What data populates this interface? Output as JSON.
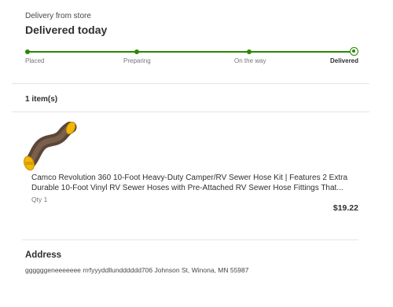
{
  "delivery": {
    "label": "Delivery from store",
    "status": "Delivered today"
  },
  "tracker": {
    "stages": [
      {
        "label": "Placed",
        "complete": true
      },
      {
        "label": "Preparing",
        "complete": true
      },
      {
        "label": "On the way",
        "complete": true
      },
      {
        "label": "Delivered",
        "complete": true,
        "current": true
      }
    ],
    "accent_color": "#2a8703"
  },
  "items": {
    "count_label": "1 item(s)",
    "list": [
      {
        "title": "Camco Revolution 360 10-Foot Heavy-Duty Camper/RV Sewer Hose Kit | Features 2 Extra Durable 10-Foot Vinyl RV Sewer Hoses with Pre-Attached RV Sewer Hose Fittings That...",
        "qty": "Qty 1",
        "price": "$19.22",
        "image_icon": "sewer-hose-image"
      }
    ]
  },
  "address": {
    "title": "Address",
    "text": "ggggggeneeeeeee rrrfyyyddllundddddd706 Johnson St, Winona, MN 55987"
  }
}
